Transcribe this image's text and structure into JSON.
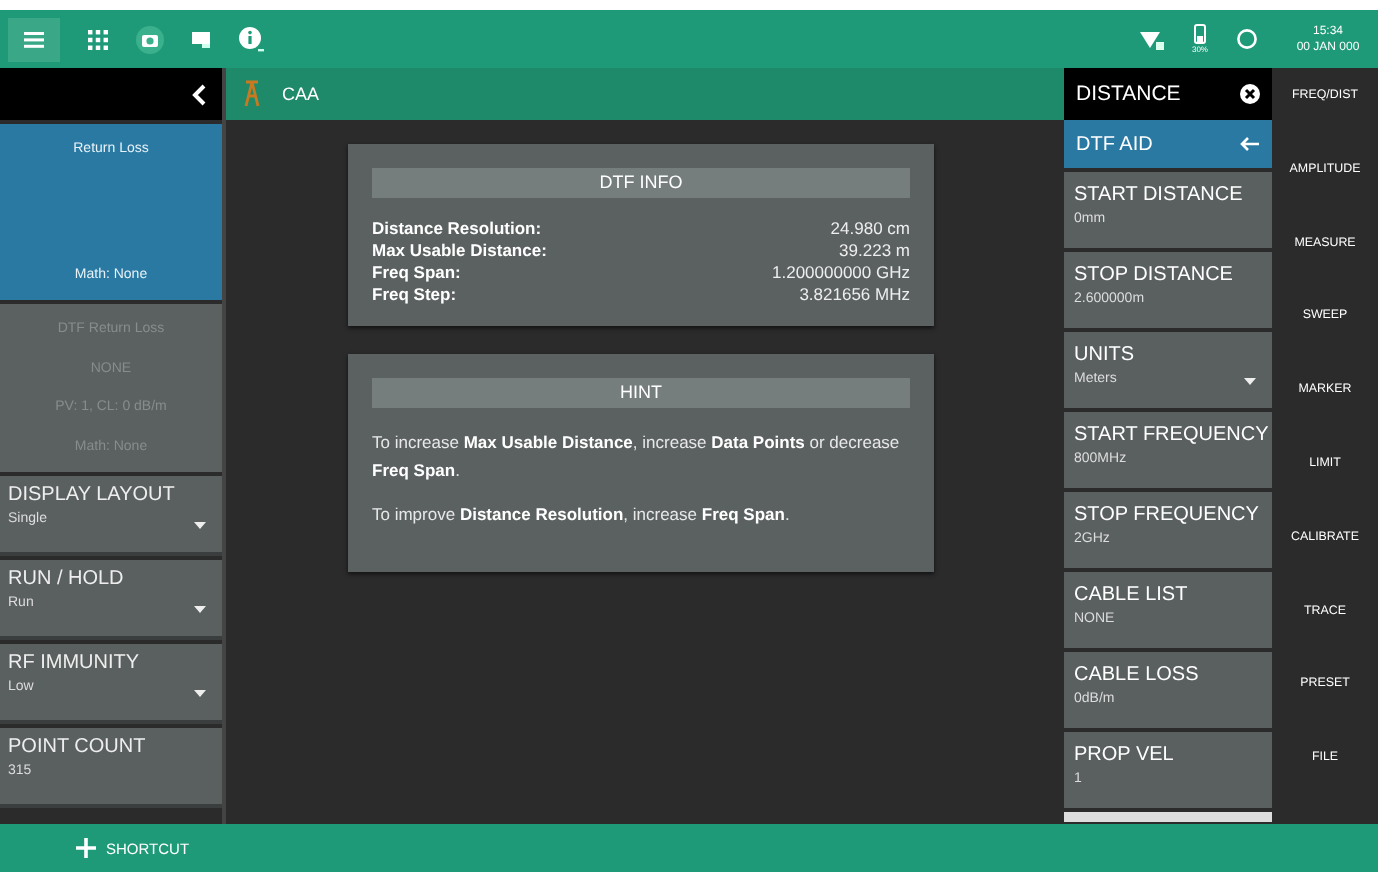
{
  "top_bar": {
    "battery_label": "30%",
    "time": "15:34",
    "date": "00 JAN 000"
  },
  "left_panel": {
    "traces": [
      {
        "selected": true,
        "lines": [
          "Return Loss",
          "Math: None"
        ]
      },
      {
        "selected": false,
        "lines": [
          "DTF Return Loss",
          "NONE",
          "PV: 1, CL: 0 dB/m",
          "Math: None"
        ]
      }
    ],
    "controls": [
      {
        "label": "DISPLAY LAYOUT",
        "value": "Single",
        "dropdown": true
      },
      {
        "label": "RUN / HOLD",
        "value": "Run",
        "dropdown": true
      },
      {
        "label": "RF IMMUNITY",
        "value": "Low",
        "dropdown": true
      },
      {
        "label": "POINT COUNT",
        "value": "315",
        "dropdown": false
      }
    ]
  },
  "main": {
    "title": "CAA",
    "dtf_info": {
      "title": "DTF INFO",
      "rows": [
        {
          "label": "Distance Resolution:",
          "value": "24.980 cm"
        },
        {
          "label": "Max Usable Distance:",
          "value": "39.223 m"
        },
        {
          "label": "Freq Span:",
          "value": "1.200000000 GHz"
        },
        {
          "label": "Freq Step:",
          "value": "3.821656 MHz"
        }
      ]
    },
    "hint": {
      "title": "HINT",
      "paragraphs": [
        "To increase **Max Usable Distance**, increase **Data Points** or decrease **Freq Span**.",
        "To improve **Distance Resolution**, increase **Freq Span**."
      ]
    }
  },
  "right_panel": {
    "title": "DISTANCE",
    "submenu": "DTF AID",
    "items": [
      {
        "label": "START DISTANCE",
        "value": "0mm",
        "dropdown": false
      },
      {
        "label": "STOP DISTANCE",
        "value": "2.600000m",
        "dropdown": false
      },
      {
        "label": "UNITS",
        "value": "Meters",
        "dropdown": true
      },
      {
        "label": "START FREQUENCY",
        "value": "800MHz",
        "dropdown": false
      },
      {
        "label": "STOP FREQUENCY",
        "value": "2GHz",
        "dropdown": false
      },
      {
        "label": "CABLE LIST",
        "value": "NONE",
        "dropdown": false
      },
      {
        "label": "CABLE LOSS",
        "value": "0dB/m",
        "dropdown": false
      },
      {
        "label": "PROP VEL",
        "value": "1",
        "dropdown": false
      }
    ]
  },
  "side_menu": [
    "FREQ/DIST",
    "AMPLITUDE",
    "MEASURE",
    "SWEEP",
    "MARKER",
    "LIMIT",
    "CALIBRATE",
    "TRACE",
    "PRESET",
    "FILE"
  ],
  "bottom_bar": {
    "shortcut": "SHORTCUT"
  }
}
